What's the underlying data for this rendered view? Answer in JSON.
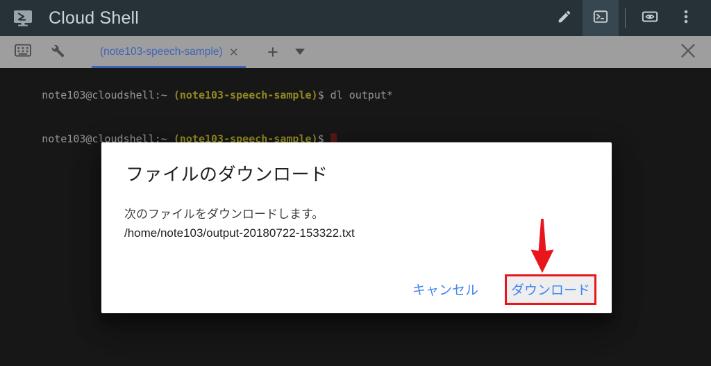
{
  "header": {
    "logo_icon": "cloud-shell-monitor-icon",
    "title": "Cloud Shell",
    "actions": [
      {
        "icon": "pencil-edit-icon",
        "name": "open-editor-button",
        "active": false
      },
      {
        "icon": "terminal-icon",
        "name": "open-terminal-button",
        "active": true
      },
      {
        "icon": "web-preview-icon",
        "name": "web-preview-button",
        "active": false
      },
      {
        "icon": "more-vert-icon",
        "name": "more-options-button",
        "active": false
      }
    ]
  },
  "toolbar": {
    "keyboard_icon": "keyboard-icon",
    "wrench_icon": "wrench-icon",
    "tab_label": "(note103-speech-sample)",
    "tab_close_glyph": "✕",
    "new_tab_glyph": "+",
    "tab_menu_icon": "caret-down-icon",
    "close_glyph": "✕"
  },
  "terminal": {
    "lines": [
      {
        "user": "note103@cloudshell:~ ",
        "project": "(note103-speech-sample)",
        "dollar": "$ ",
        "command": "dl output*",
        "cursor": false
      },
      {
        "user": "note103@cloudshell:~ ",
        "project": "(note103-speech-sample)",
        "dollar": "$ ",
        "command": "",
        "cursor": true
      }
    ]
  },
  "dialog": {
    "title": "ファイルのダウンロード",
    "body_text": "次のファイルをダウンロードします。",
    "file_path": "/home/note103/output-20180722-153322.txt",
    "cancel_label": "キャンセル",
    "download_label": "ダウンロード"
  },
  "annotation": {
    "arrow_icon": "red-down-arrow-icon",
    "highlight_color": "#e8161a",
    "target": "download-button"
  },
  "colors": {
    "header_bg": "#263238",
    "toolbar_bg": "#9e9e9e",
    "terminal_bg": "#212121",
    "link_blue": "#4285f4",
    "prompt_yellow": "#cfc22f",
    "annotation_red": "#e8161a"
  }
}
